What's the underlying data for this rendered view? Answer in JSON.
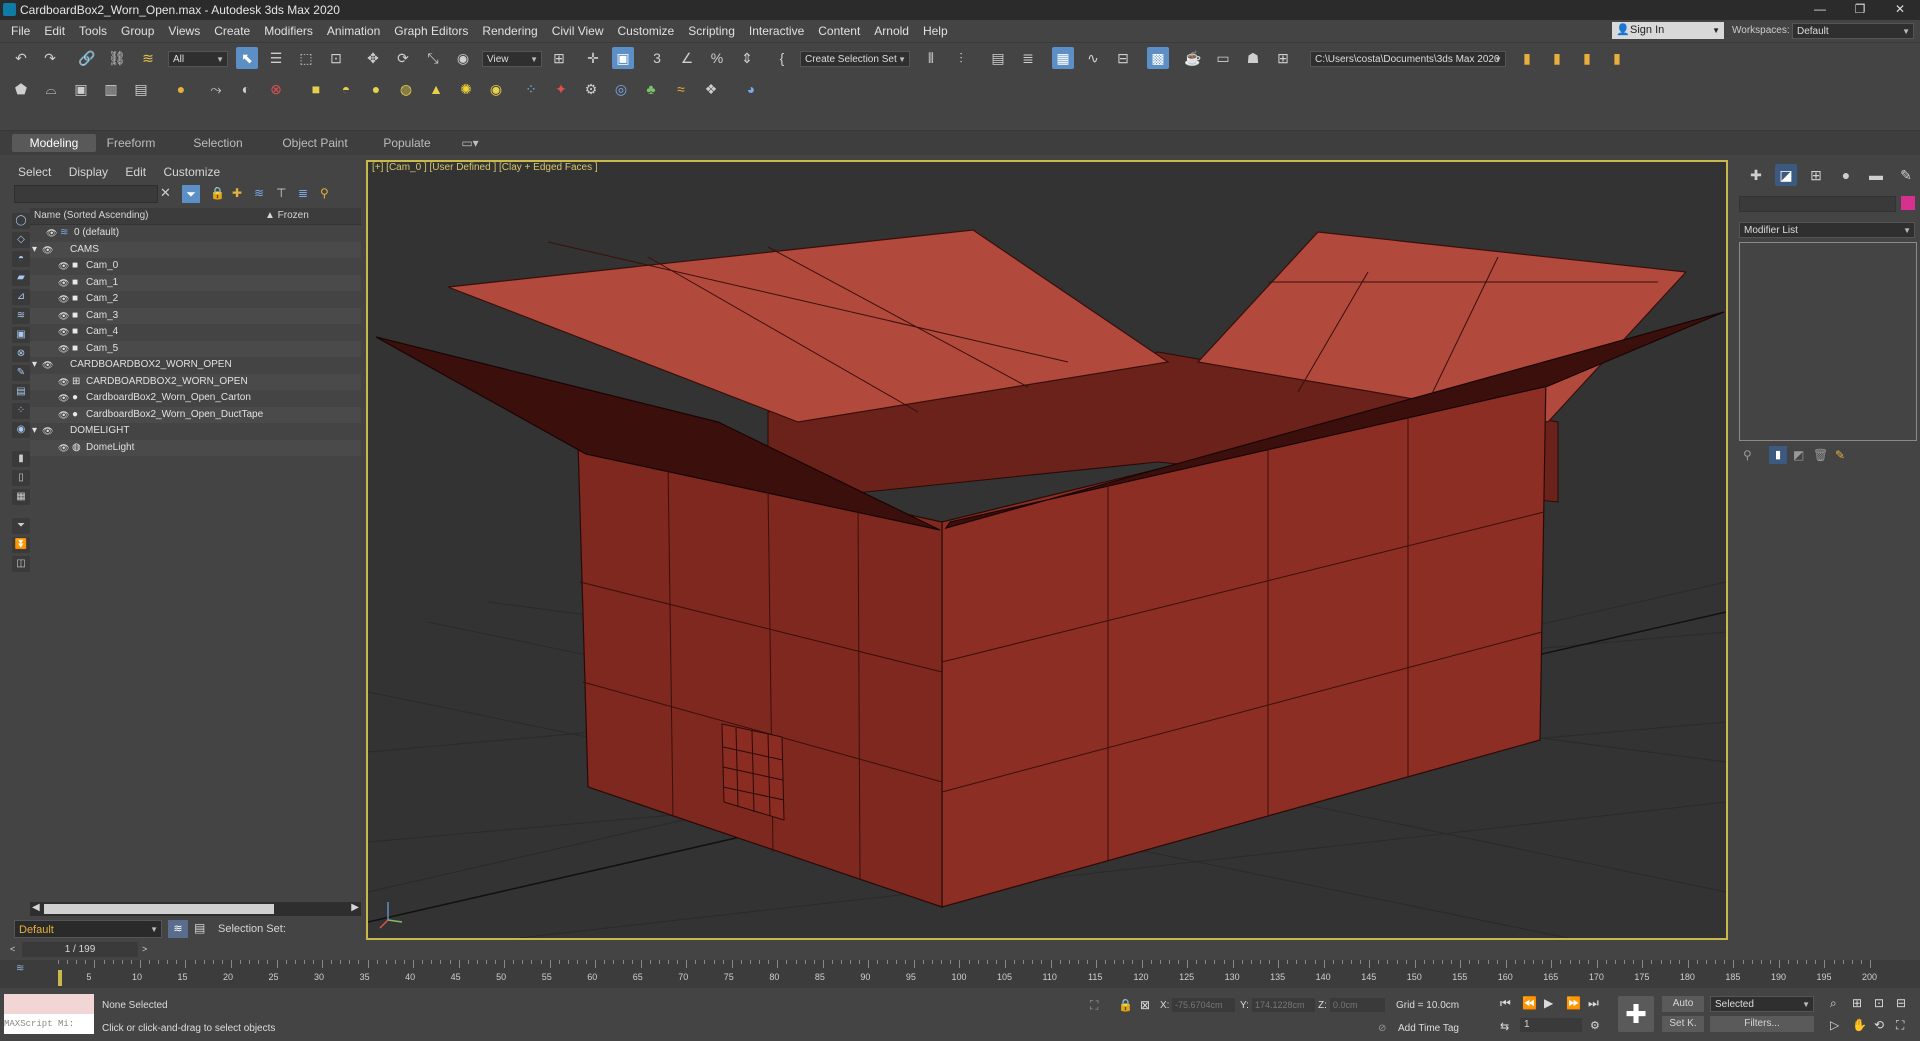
{
  "window": {
    "title": "CardboardBox2_Worn_Open.max - Autodesk 3ds Max 2020",
    "minimize": "—",
    "restore": "❐",
    "close": "✕"
  },
  "menu": [
    "File",
    "Edit",
    "Tools",
    "Group",
    "Views",
    "Create",
    "Modifiers",
    "Animation",
    "Graph Editors",
    "Rendering",
    "Civil View",
    "Customize",
    "Scripting",
    "Interactive",
    "Content",
    "Arnold",
    "Help"
  ],
  "account": {
    "sign_in": "Sign In",
    "workspaces_label": "Workspaces:",
    "workspace": "Default"
  },
  "toolbar": {
    "filter": "All",
    "ref_coord": "View",
    "selection_set": "Create Selection Set",
    "project_path": "C:\\Users\\costa\\Documents\\3ds Max 2020"
  },
  "ribbon_tabs": [
    "Modeling",
    "Freeform",
    "Selection",
    "Object Paint",
    "Populate"
  ],
  "explorer": {
    "tabs": [
      "Select",
      "Display",
      "Edit",
      "Customize"
    ],
    "column_name": "Name (Sorted Ascending)",
    "column_frozen": "▲ Frozen",
    "rows": [
      {
        "label": "0 (default)",
        "indent": 1,
        "type": "layer"
      },
      {
        "label": "CAMS",
        "indent": 0,
        "type": "group"
      },
      {
        "label": "Cam_0",
        "indent": 2,
        "type": "camera"
      },
      {
        "label": "Cam_1",
        "indent": 2,
        "type": "camera"
      },
      {
        "label": "Cam_2",
        "indent": 2,
        "type": "camera"
      },
      {
        "label": "Cam_3",
        "indent": 2,
        "type": "camera"
      },
      {
        "label": "Cam_4",
        "indent": 2,
        "type": "camera"
      },
      {
        "label": "Cam_5",
        "indent": 2,
        "type": "camera"
      },
      {
        "label": "CARDBOARDBOX2_WORN_OPEN",
        "indent": 0,
        "type": "group"
      },
      {
        "label": "CARDBOARDBOX2_WORN_OPEN",
        "indent": 2,
        "type": "helper"
      },
      {
        "label": "CardboardBox2_Worn_Open_Carton",
        "indent": 2,
        "type": "mesh"
      },
      {
        "label": "CardboardBox2_Worn_Open_DuctTape",
        "indent": 2,
        "type": "mesh"
      },
      {
        "label": "DOMELIGHT",
        "indent": 0,
        "type": "group"
      },
      {
        "label": "DomeLight",
        "indent": 2,
        "type": "light"
      }
    ],
    "layer": "Default",
    "selection_set_label": "Selection Set:"
  },
  "viewport": {
    "label": "[+] [Cam_0 ] [User Defined ] [Clay + Edged Faces ]"
  },
  "command_panel": {
    "modifier_list": "Modifier List"
  },
  "timeline": {
    "frame": "1 / 199",
    "ticks": [
      "5",
      "10",
      "15",
      "20",
      "25",
      "30",
      "35",
      "40",
      "45",
      "50",
      "55",
      "60",
      "65",
      "70",
      "75",
      "80",
      "85",
      "90",
      "95",
      "100",
      "105",
      "110",
      "115",
      "120",
      "125",
      "130",
      "135",
      "140",
      "145",
      "150",
      "155",
      "160",
      "165",
      "170",
      "175",
      "180",
      "185",
      "190",
      "195",
      "200"
    ]
  },
  "status": {
    "maxscript": "MAXScript Mi:",
    "selected": "None Selected",
    "prompt": "Click or click-and-drag to select objects",
    "x_label": "X:",
    "x_value": "-75.6704cm",
    "y_label": "Y:",
    "y_value": "174.1228cm",
    "z_label": "Z:",
    "z_value": "0.0cm",
    "grid": "Grid = 10.0cm",
    "add_time_tag": "Add Time Tag",
    "auto": "Auto",
    "set_key": "Set K.",
    "key_filter": "Selected",
    "filters": "Filters...",
    "current_frame": "1"
  },
  "colors": {
    "accent": "#5b8fc6",
    "viewport_border": "#c8b94a",
    "box": "#8c2e24"
  }
}
